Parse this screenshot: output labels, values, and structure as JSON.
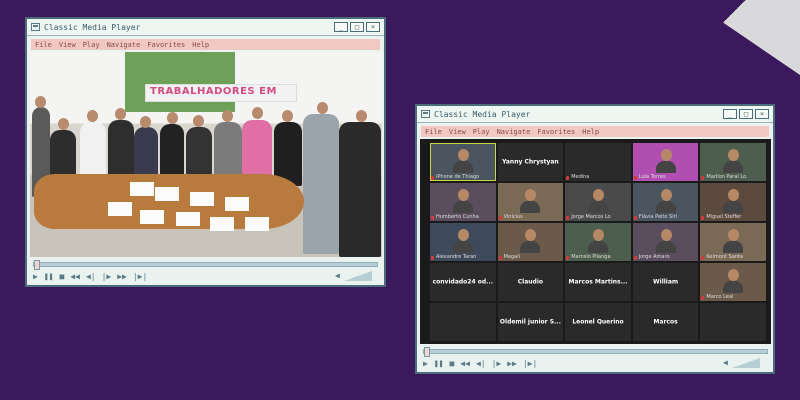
{
  "left_window": {
    "title": "Classic Media Player",
    "menu": [
      "File",
      "View",
      "Play",
      "Navigate",
      "Favorites",
      "Help"
    ],
    "photo_banner": "TRABALHADORES EM",
    "progress": 0.02,
    "controls": [
      "play-icon",
      "pause-icon",
      "stop-icon",
      "rewind-icon",
      "prev-icon",
      "next-icon",
      "fast-forward-icon",
      "frame-icon"
    ],
    "volume": 0.9
  },
  "right_window": {
    "title": "Classic Media Player",
    "menu": [
      "File",
      "View",
      "Play",
      "Navigate",
      "Favorites",
      "Help"
    ],
    "progress": 0.02,
    "controls": [
      "play-icon",
      "pause-icon",
      "stop-icon",
      "rewind-icon",
      "prev-icon",
      "next-icon",
      "fast-forward-icon",
      "frame-icon"
    ],
    "volume": 0.9,
    "participants": [
      {
        "name": "iPhone de Thiago",
        "video": true,
        "active": true
      },
      {
        "name": "Yanny Chrystyan",
        "video": false,
        "center": true
      },
      {
        "name": "Medina",
        "video": false
      },
      {
        "name": "Lula Torres",
        "video": true,
        "slide": true
      },
      {
        "name": "Marllon Paraí Lo",
        "video": true
      },
      {
        "name": "Humberto Cunha",
        "video": true
      },
      {
        "name": "Vinícius",
        "video": true
      },
      {
        "name": "Jorge Marcos Lo",
        "video": true
      },
      {
        "name": "Flávia Peito Sirí",
        "video": true
      },
      {
        "name": "Miguel Steffer",
        "video": true
      },
      {
        "name": "Alexandre Taran",
        "video": true
      },
      {
        "name": "Magali",
        "video": true
      },
      {
        "name": "Marcelo Pilanga",
        "video": true
      },
      {
        "name": "Jorge Amaro",
        "video": true
      },
      {
        "name": "Kelmont Santa",
        "video": true
      },
      {
        "name": "convidado24 od...",
        "video": false,
        "center": true
      },
      {
        "name": "Claudio",
        "video": false,
        "center": true
      },
      {
        "name": "Marcos Martins...",
        "video": false,
        "center": true
      },
      {
        "name": "William",
        "video": false,
        "center": true
      },
      {
        "name": "Marco Leal",
        "video": true
      },
      {
        "name": "",
        "video": false
      },
      {
        "name": "Oldemil junior S...",
        "video": false,
        "center": true
      },
      {
        "name": "Leonel Querino",
        "video": false,
        "center": true
      },
      {
        "name": "Marcos",
        "video": false,
        "center": true
      },
      {
        "name": "",
        "video": false
      }
    ]
  },
  "colors": {
    "background": "#3a1a5c",
    "window_bg": "#e9f2ee",
    "menubar": "#f1c8c2",
    "active_speaker": "#c8d44a"
  }
}
